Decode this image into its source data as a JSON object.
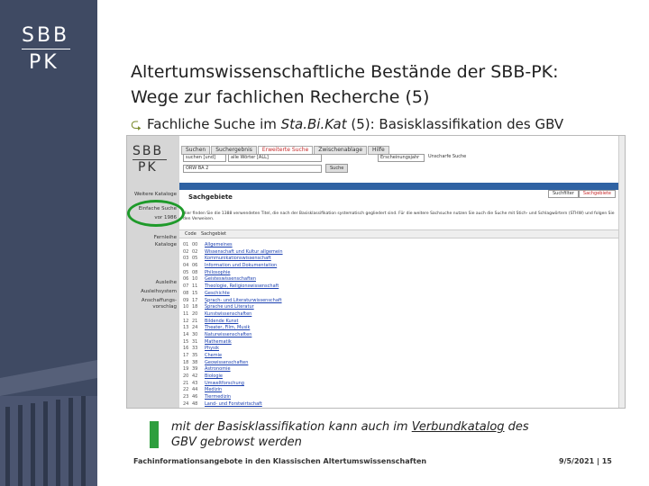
{
  "brand": {
    "logo_top": "SBB",
    "logo_bottom": "PK"
  },
  "slide": {
    "title_line1": "Altertumswissenschaftliche Bestände der SBB-PK:",
    "title_line2": "Wege zur fachlichen Recherche (5)",
    "bullet_pre": "Fachliche Suche im ",
    "bullet_em": "Sta.Bi.Kat",
    "bullet_post": " (5): Basisklassifikation des GBV"
  },
  "screenshot": {
    "logo_top": "SBB",
    "logo_bottom": "PK",
    "tabs": [
      "Suchen",
      "Suchergebnis",
      "Erweiterte Suche",
      "Zwischenablage",
      "Hilfe"
    ],
    "active_tab": 2,
    "search_field": "suchen [und]",
    "search_scope": "alle Wörter [ALL]",
    "query": "ORW BA 2",
    "sort_label": "Erscheinungsjahr",
    "flag_label": "Unscharfe Suche",
    "search_button": "Suche",
    "subtabs": [
      "Suchfilter",
      "Sachgebiete"
    ],
    "side_items": [
      "Weitere Kataloge",
      "Einfache Suche",
      "vor 1986",
      "Fernleihe",
      "Kataloge",
      "Ausleihe",
      "Ausleihsystem",
      "Anschaffungs-",
      "vorschlag"
    ],
    "section_title": "Sachgebiete",
    "description": "Hier finden Sie die 1388 verwendeten Titel, die nach der Basisklassifikation systematisch gegliedert sind. Für die weitere Sachsuche nutzen Sie auch die Suche mit Stich- und Schlagwörtern (STHW) und folgen Sie den Verweisen.",
    "column_code": "Code",
    "column_subject": "Sachgebiet",
    "items": [
      {
        "n": "01",
        "c": "00",
        "t": "Allgemeines"
      },
      {
        "n": "02",
        "c": "02",
        "t": "Wissenschaft und Kultur allgemein"
      },
      {
        "n": "03",
        "c": "05",
        "t": "Kommunikationswissenschaft"
      },
      {
        "n": "04",
        "c": "06",
        "t": "Information und Dokumentation"
      },
      {
        "n": "05",
        "c": "08",
        "t": "Philosophie"
      },
      {
        "n": "06",
        "c": "10",
        "t": "Geisteswissenschaften"
      },
      {
        "n": "07",
        "c": "11",
        "t": "Theologie, Religionswissenschaft"
      },
      {
        "n": "08",
        "c": "15",
        "t": "Geschichte"
      },
      {
        "n": "09",
        "c": "17",
        "t": "Sprach- und Literaturwissenschaft"
      },
      {
        "n": "10",
        "c": "18",
        "t": "Sprache und Literatur"
      },
      {
        "n": "11",
        "c": "20",
        "t": "Kunstwissenschaften"
      },
      {
        "n": "12",
        "c": "21",
        "t": "Bildende Kunst"
      },
      {
        "n": "13",
        "c": "24",
        "t": "Theater, Film, Musik"
      },
      {
        "n": "14",
        "c": "30",
        "t": "Naturwissenschaften"
      },
      {
        "n": "15",
        "c": "31",
        "t": "Mathematik"
      },
      {
        "n": "16",
        "c": "33",
        "t": "Physik"
      },
      {
        "n": "17",
        "c": "35",
        "t": "Chemie"
      },
      {
        "n": "18",
        "c": "38",
        "t": "Geowissenschaften"
      },
      {
        "n": "19",
        "c": "39",
        "t": "Astronomie"
      },
      {
        "n": "20",
        "c": "42",
        "t": "Biologie"
      },
      {
        "n": "21",
        "c": "43",
        "t": "Umweltforschung"
      },
      {
        "n": "22",
        "c": "44",
        "t": "Medizin"
      },
      {
        "n": "23",
        "c": "46",
        "t": "Tiermedizin"
      },
      {
        "n": "24",
        "c": "48",
        "t": "Land- und Forstwirtschaft"
      }
    ]
  },
  "note": {
    "pre": "mit der Basisklassifikation kann auch im ",
    "link": "Verbundkatalog",
    "post": " des",
    "line2": "GBV gebrowst werden"
  },
  "footer": {
    "left": "Fachinformationsangebote in den Klassischen Altertumswissenschaften",
    "right": "9/5/2021 | 15"
  },
  "colors": {
    "brand": "#3f4a63",
    "accent_green": "#2e9f3e",
    "link": "#1a3fb0"
  }
}
